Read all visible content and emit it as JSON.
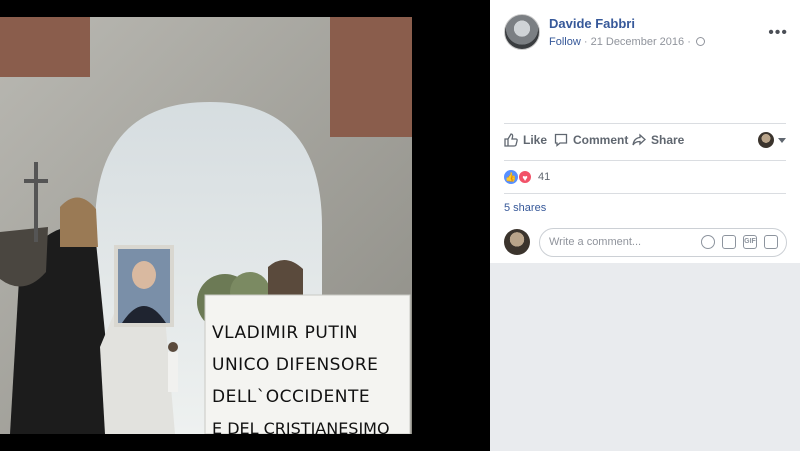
{
  "post": {
    "author": "Davide Fabbri",
    "follow_label": "Follow",
    "separator": " · ",
    "date": "21 December 2016",
    "separator2": " · "
  },
  "actions": {
    "like_label": "Like",
    "comment_label": "Comment",
    "share_label": "Share"
  },
  "reactions": {
    "count": "41"
  },
  "shares_label": "5 shares",
  "comment_box": {
    "placeholder": "Write a comment..."
  },
  "photo": {
    "sign_lines": [
      "VLADIMIR PUTIN",
      "UNICO DIFENSORE",
      "DELL`OCCIDENTE",
      "E DEL CRISTIANESIMO"
    ]
  },
  "icons": {
    "more": "more-options-icon",
    "globe": "globe-icon",
    "like": "thumbs-up-icon",
    "comment": "speech-bubble-icon",
    "share": "share-arrow-icon",
    "emoji": "emoji-icon",
    "camera": "camera-icon",
    "gif": "gif-icon",
    "sticker": "sticker-icon"
  },
  "colors": {
    "link": "#365899",
    "like_reaction": "#5890ff",
    "love_reaction": "#f25268"
  }
}
